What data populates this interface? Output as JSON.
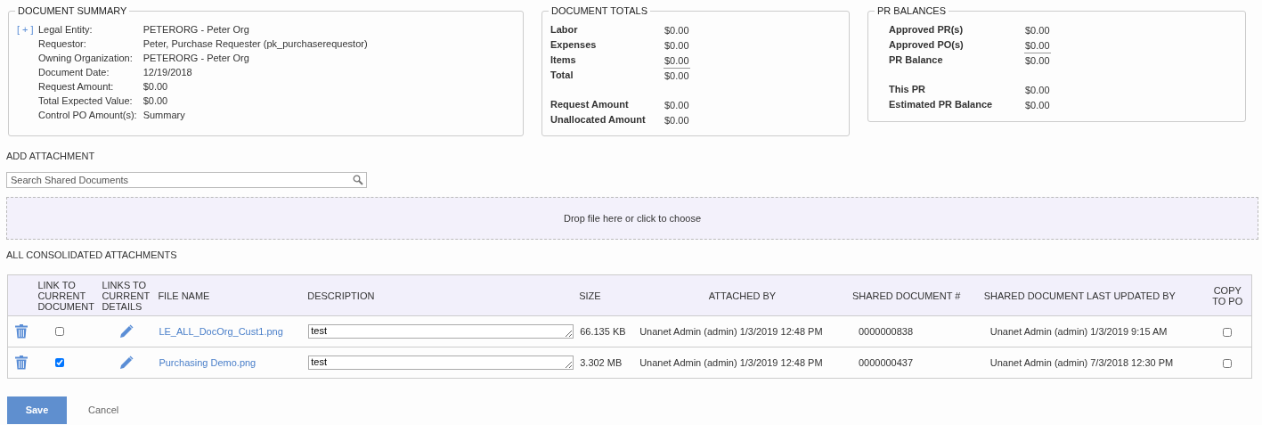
{
  "document_summary": {
    "title": "DOCUMENT SUMMARY",
    "expand_toggle": "[ + ]",
    "rows": [
      {
        "label": "Legal Entity:",
        "value": "PETERORG - Peter Org"
      },
      {
        "label": "Requestor:",
        "value": "Peter, Purchase Requester (pk_purchaserequestor)"
      },
      {
        "label": "Owning Organization:",
        "value": "PETERORG - Peter Org"
      },
      {
        "label": "Document Date:",
        "value": "12/19/2018"
      },
      {
        "label": "Request Amount:",
        "value": "$0.00"
      },
      {
        "label": "Total Expected Value:",
        "value": "$0.00"
      },
      {
        "label": "Control PO Amount(s):",
        "value": "Summary"
      }
    ]
  },
  "document_totals": {
    "title": "DOCUMENT TOTALS",
    "groups": [
      [
        {
          "label": "Labor",
          "value": "$0.00",
          "rule_above": false
        },
        {
          "label": "Expenses",
          "value": "$0.00",
          "rule_above": false
        },
        {
          "label": "Items",
          "value": "$0.00",
          "rule_above": false
        },
        {
          "label": "Total",
          "value": "$0.00",
          "rule_above": true
        }
      ],
      [
        {
          "label": "Request Amount",
          "value": "$0.00",
          "rule_above": false
        },
        {
          "label": "Unallocated Amount",
          "value": "$0.00",
          "rule_above": false
        }
      ]
    ]
  },
  "pr_balances": {
    "title": "PR BALANCES",
    "groups": [
      [
        {
          "label": "Approved PR(s)",
          "value": "$0.00",
          "rule_above": false
        },
        {
          "label": "Approved PO(s)",
          "value": "$0.00",
          "rule_above": false
        },
        {
          "label": "PR Balance",
          "value": "$0.00",
          "rule_above": true
        }
      ],
      [
        {
          "label": "This PR",
          "value": "$0.00",
          "rule_above": false
        },
        {
          "label": "Estimated PR Balance",
          "value": "$0.00",
          "rule_above": false
        }
      ]
    ]
  },
  "add_attachment": {
    "heading": "ADD ATTACHMENT",
    "search": {
      "placeholder": "Search Shared Documents"
    },
    "dropzone": "Drop file here or click to choose"
  },
  "attachments": {
    "heading": "ALL CONSOLIDATED ATTACHMENTS",
    "columns": [
      "LINK TO CURRENT DOCUMENT",
      "LINKS TO CURRENT DETAILS",
      "FILE NAME",
      "DESCRIPTION",
      "SIZE",
      "ATTACHED BY",
      "SHARED DOCUMENT #",
      "SHARED DOCUMENT LAST UPDATED BY",
      "COPY TO PO"
    ],
    "rows": [
      {
        "linked": false,
        "file_name": "LE_ALL_DocOrg_Cust1.png",
        "description": "test",
        "size": "66.135 KB",
        "attached_by": "Unanet Admin (admin) 1/3/2019 12:48 PM",
        "shared_document": "0000000838",
        "last_updated_by": "Unanet Admin (admin) 1/3/2019 9:15 AM",
        "copy_to_po": false
      },
      {
        "linked": true,
        "file_name": "Purchasing Demo.png",
        "description": "test",
        "size": "3.302 MB",
        "attached_by": "Unanet Admin (admin) 1/3/2019 12:48 PM",
        "shared_document": "0000000437",
        "last_updated_by": "Unanet Admin (admin) 7/3/2018 12:30 PM",
        "copy_to_po": false
      }
    ]
  },
  "buttons": {
    "save": "Save",
    "cancel": "Cancel"
  }
}
